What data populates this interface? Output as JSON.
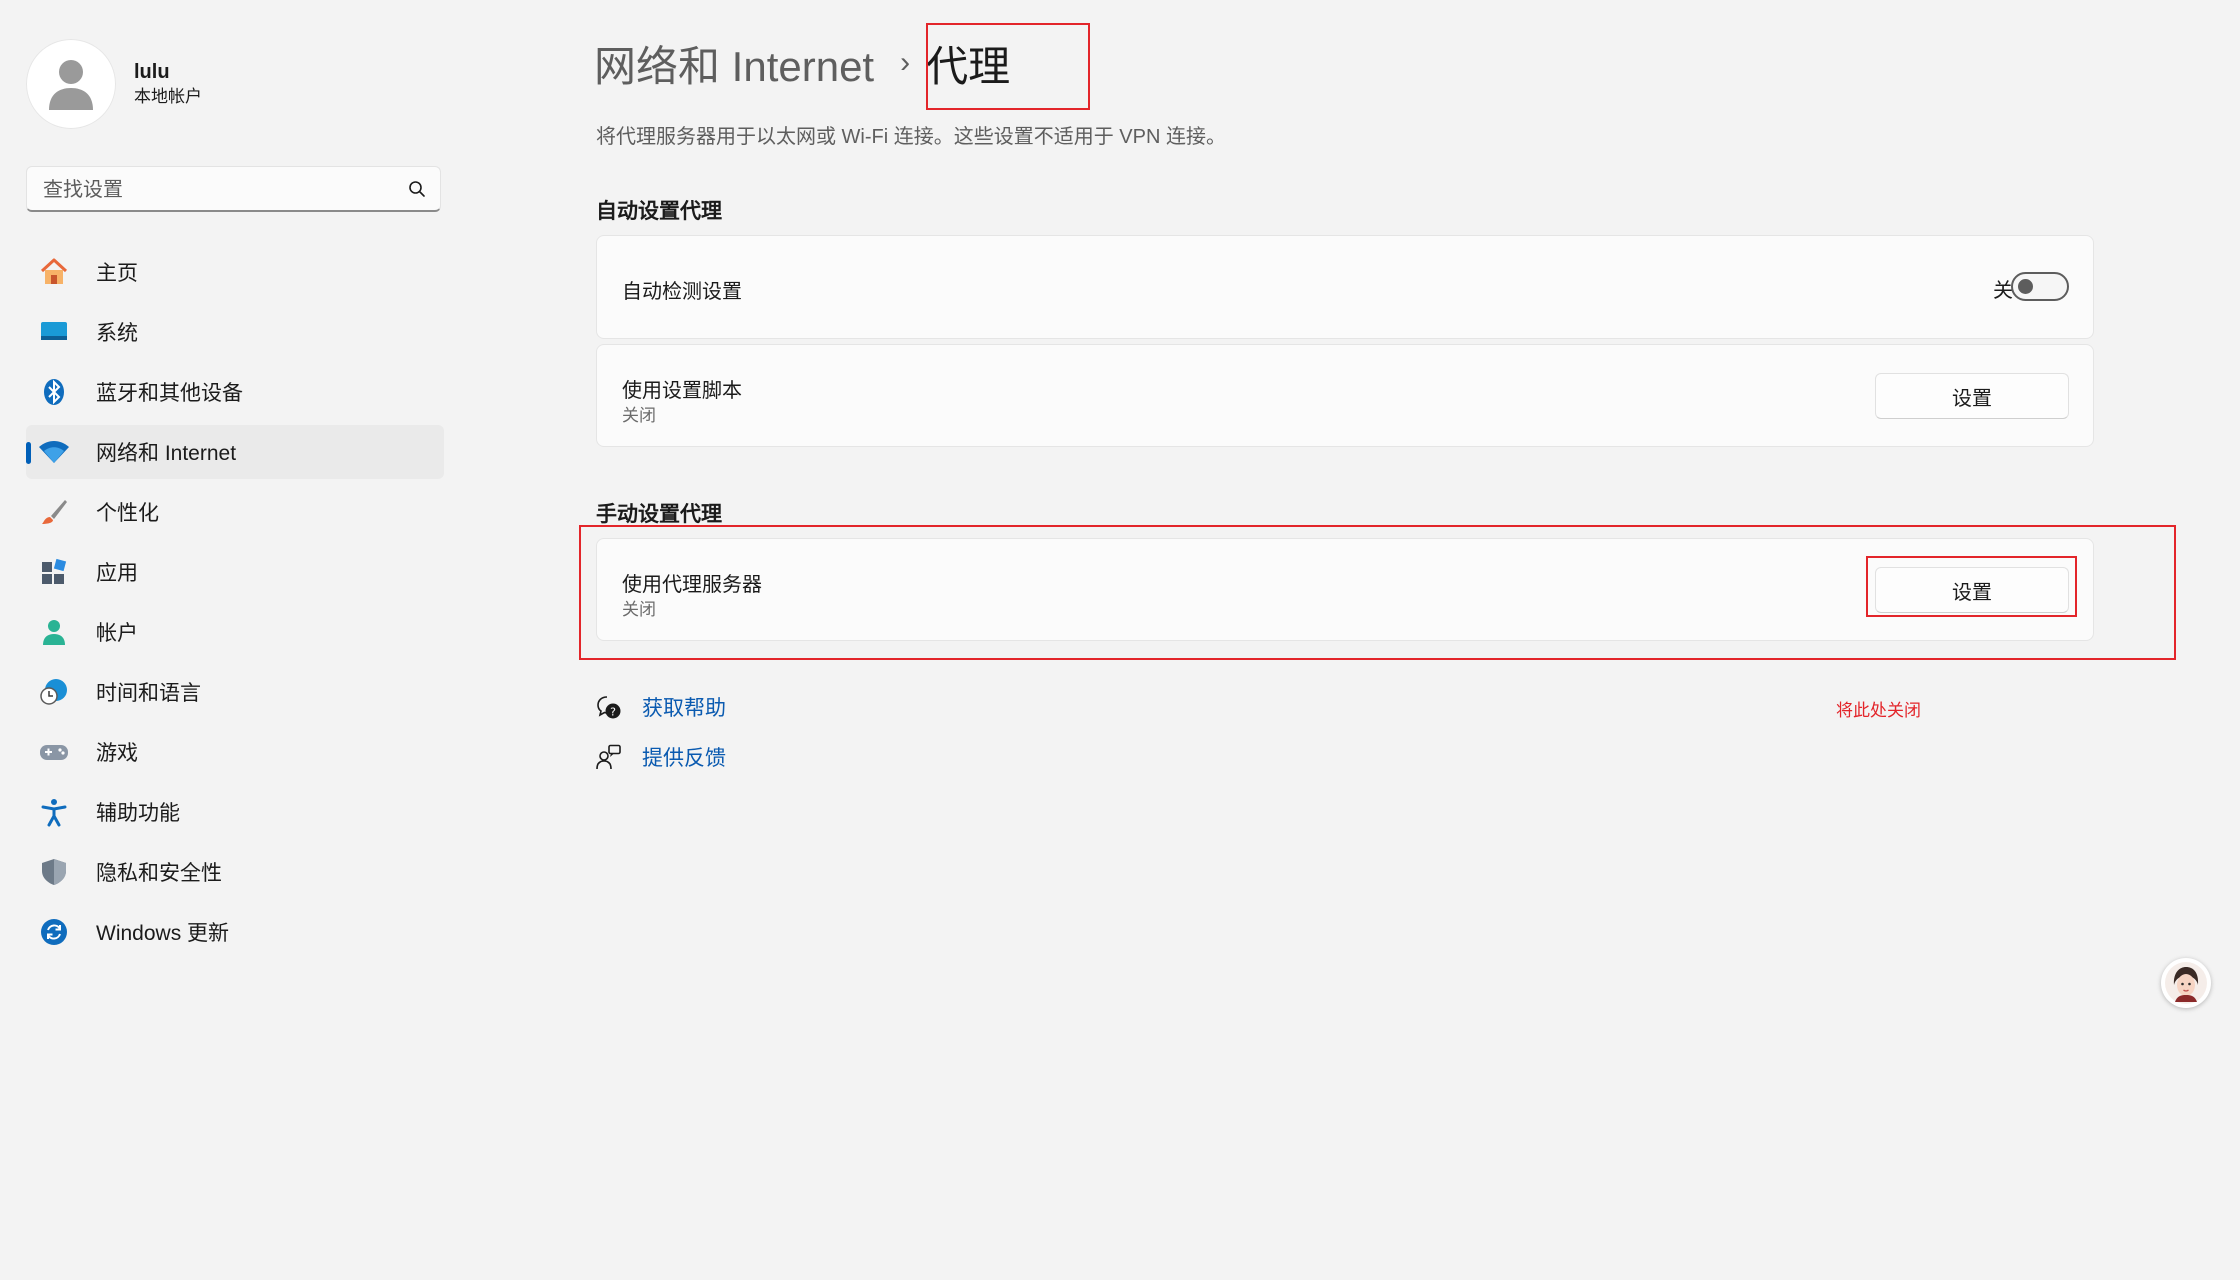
{
  "profile": {
    "name": "lulu",
    "account_type": "本地帐户"
  },
  "search": {
    "placeholder": "查找设置"
  },
  "nav": {
    "items": [
      {
        "label": "主页",
        "icon": "home-icon"
      },
      {
        "label": "系统",
        "icon": "system-icon"
      },
      {
        "label": "蓝牙和其他设备",
        "icon": "bluetooth-icon"
      },
      {
        "label": "网络和 Internet",
        "icon": "wifi-icon",
        "active": true
      },
      {
        "label": "个性化",
        "icon": "brush-icon"
      },
      {
        "label": "应用",
        "icon": "apps-icon"
      },
      {
        "label": "帐户",
        "icon": "account-icon"
      },
      {
        "label": "时间和语言",
        "icon": "globe-clock-icon"
      },
      {
        "label": "游戏",
        "icon": "gamepad-icon"
      },
      {
        "label": "辅助功能",
        "icon": "accessibility-icon"
      },
      {
        "label": "隐私和安全性",
        "icon": "shield-icon"
      },
      {
        "label": "Windows 更新",
        "icon": "update-icon"
      }
    ]
  },
  "header": {
    "parent": "网络和 Internet",
    "separator": "›",
    "current": "代理",
    "description": "将代理服务器用于以太网或 Wi-Fi 连接。这些设置不适用于 VPN 连接。"
  },
  "auto_proxy": {
    "title": "自动设置代理",
    "detect": {
      "label": "自动检测设置",
      "toggle_text": "关",
      "state": false
    },
    "script": {
      "label": "使用设置脚本",
      "sub": "关闭",
      "button": "设置"
    }
  },
  "manual_proxy": {
    "title": "手动设置代理",
    "server": {
      "label": "使用代理服务器",
      "sub": "关闭",
      "button": "设置"
    }
  },
  "links": {
    "help": "获取帮助",
    "feedback": "提供反馈"
  },
  "annotation": {
    "note": "将此处关闭",
    "color": "#e3252a"
  },
  "colors": {
    "accent": "#005fb8",
    "link": "#0a5ab0",
    "background": "#f3f3f3"
  }
}
